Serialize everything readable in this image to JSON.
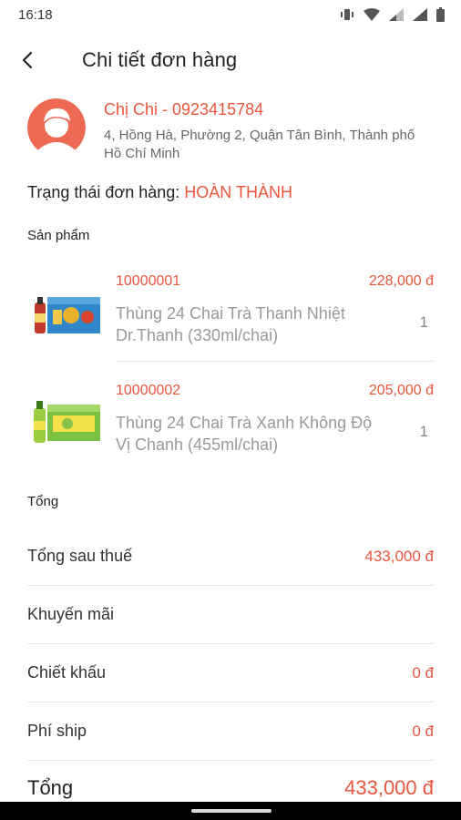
{
  "status_bar": {
    "time": "16:18"
  },
  "header": {
    "title": "Chi tiết đơn hàng"
  },
  "customer": {
    "name": "Chị Chi - 0923415784",
    "address": "4, Hồng Hà, Phường 2, Quận Tân Bình, Thành phố Hồ Chí Minh"
  },
  "order_status": {
    "label": "Trạng thái đơn hàng:",
    "value": "HOÀN THÀNH"
  },
  "products_section": {
    "label": "Sản phẩm"
  },
  "products": [
    {
      "code": "10000001",
      "price": "228,000 đ",
      "name": "Thùng 24 Chai Trà Thanh Nhiệt Dr.Thanh (330ml/chai)",
      "qty": "1"
    },
    {
      "code": "10000002",
      "price": "205,000 đ",
      "name": "Thùng 24 Chai Trà Xanh Không Độ Vị Chanh (455ml/chai)",
      "qty": "1"
    }
  ],
  "summary_section": {
    "label": "Tổng"
  },
  "summary": [
    {
      "label": "Tổng sau thuế",
      "value": "433,000 đ"
    },
    {
      "label": "Khuyến mãi",
      "value": ""
    },
    {
      "label": "Chiết khấu",
      "value": "0 đ"
    },
    {
      "label": "Phí ship",
      "value": "0 đ"
    }
  ],
  "total": {
    "label": "Tổng",
    "value": "433,000 đ"
  },
  "colors": {
    "accent": "#e9563c",
    "muted": "#999999"
  }
}
